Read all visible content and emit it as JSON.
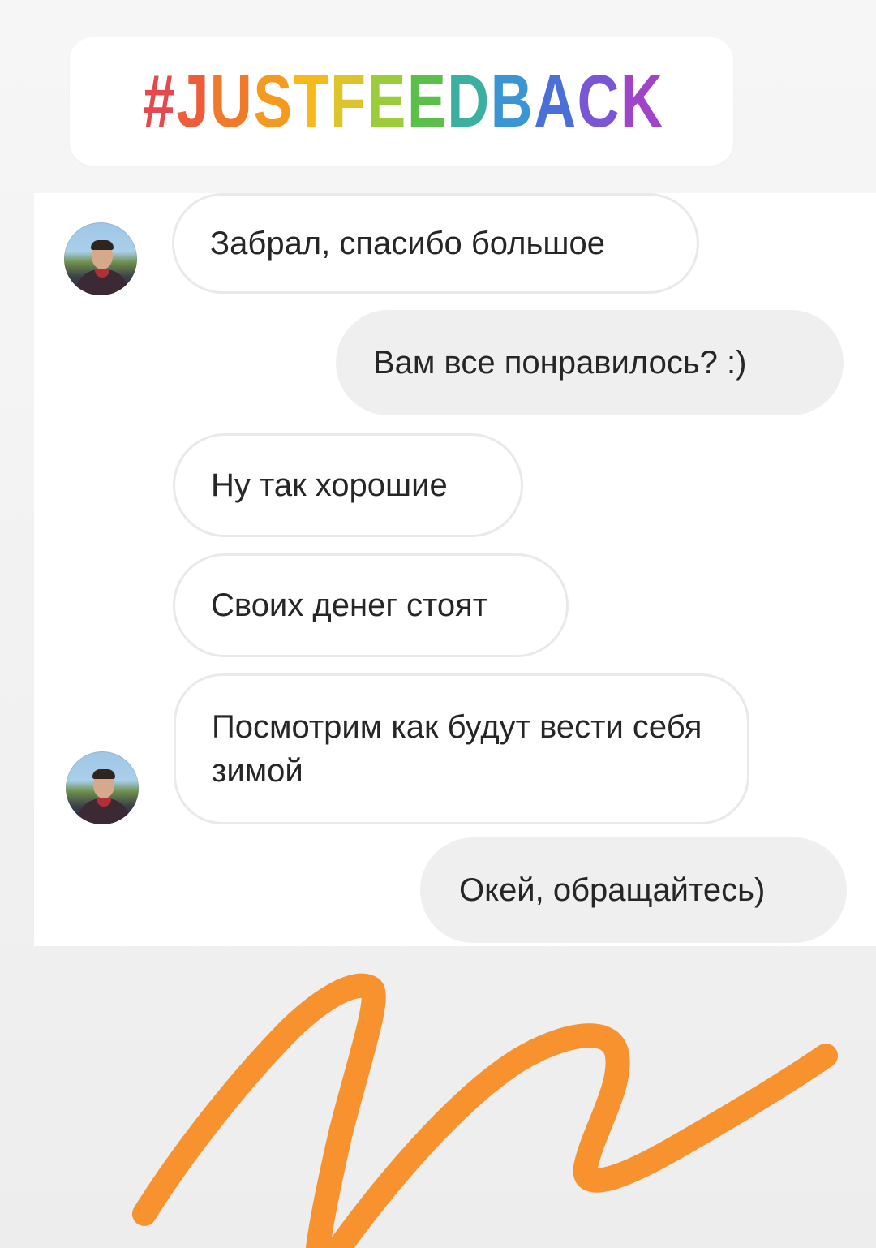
{
  "hashtag": {
    "letters": [
      "#",
      "J",
      "U",
      "S",
      "T",
      "F",
      "E",
      "E",
      "D",
      "B",
      "A",
      "C",
      "K"
    ],
    "colors": [
      "#e5484d",
      "#ee5c3a",
      "#f07a2a",
      "#f59a1e",
      "#f6b81b",
      "#dcc52a",
      "#9ccc3c",
      "#5cbf4a",
      "#3bb0a0",
      "#3b95d4",
      "#4a6fd6",
      "#7a55d4",
      "#a145c8"
    ]
  },
  "conversation": {
    "messages": [
      {
        "side": "received",
        "text": "Забрал, спасибо большое"
      },
      {
        "side": "sent",
        "text": "Вам все понравилось? :)"
      },
      {
        "side": "received",
        "text": "Ну так хорошие"
      },
      {
        "side": "received",
        "text": "Своих денег стоят"
      },
      {
        "side": "received",
        "text": "Посмотрим как будут вести себя зимой"
      },
      {
        "side": "sent",
        "text": "Окей, обращайтесь)"
      }
    ]
  },
  "colors": {
    "received_bubble": "#ffffff",
    "received_border": "#e9e9e9",
    "sent_bubble": "#efefef",
    "text": "#262626",
    "scribble": "#f7922f"
  },
  "icons": {
    "avatar": "contact-avatar-photo"
  }
}
